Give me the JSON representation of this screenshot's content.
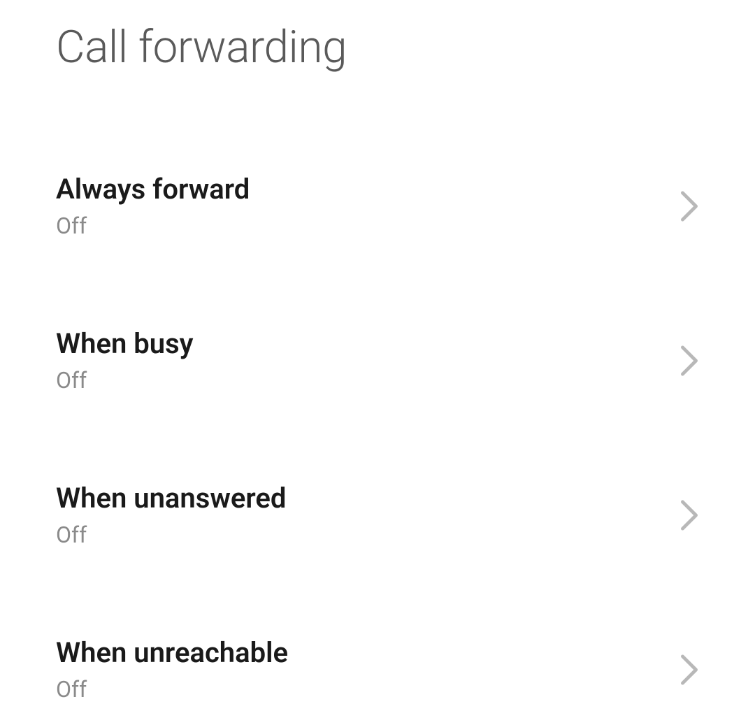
{
  "header": {
    "title": "Call forwarding"
  },
  "settings": {
    "items": [
      {
        "title": "Always forward",
        "status": "Off"
      },
      {
        "title": "When busy",
        "status": "Off"
      },
      {
        "title": "When unanswered",
        "status": "Off"
      },
      {
        "title": "When unreachable",
        "status": "Off"
      }
    ]
  }
}
